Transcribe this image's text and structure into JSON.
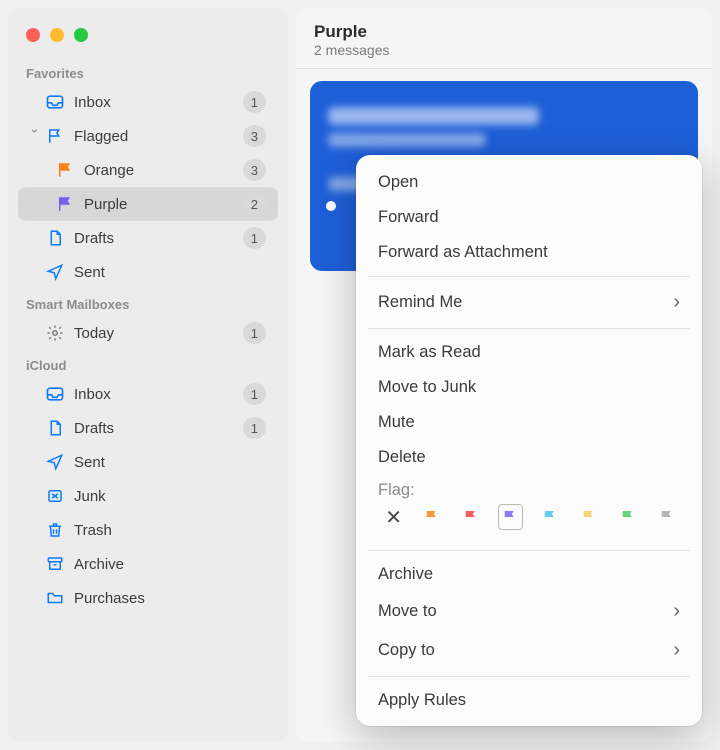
{
  "sidebar": {
    "sections": {
      "favorites": "Favorites",
      "smart": "Smart Mailboxes",
      "icloud": "iCloud"
    },
    "fav": {
      "inbox": {
        "label": "Inbox",
        "count": "1"
      },
      "flagged": {
        "label": "Flagged",
        "count": "3"
      },
      "orange": {
        "label": "Orange",
        "count": "3"
      },
      "purple": {
        "label": "Purple",
        "count": "2"
      },
      "drafts": {
        "label": "Drafts",
        "count": "1"
      },
      "sent": {
        "label": "Sent"
      }
    },
    "smart": {
      "today": {
        "label": "Today",
        "count": "1"
      }
    },
    "icloud": {
      "inbox": {
        "label": "Inbox",
        "count": "1"
      },
      "drafts": {
        "label": "Drafts",
        "count": "1"
      },
      "sent": {
        "label": "Sent"
      },
      "junk": {
        "label": "Junk"
      },
      "trash": {
        "label": "Trash"
      },
      "archive": {
        "label": "Archive"
      },
      "purchases": {
        "label": "Purchases"
      }
    }
  },
  "main": {
    "title": "Purple",
    "messages_count": "2 messages"
  },
  "context_menu": {
    "open": "Open",
    "forward": "Forward",
    "forward_attachment": "Forward as Attachment",
    "remind_me": "Remind Me",
    "mark_as_read": "Mark as Read",
    "move_to_junk": "Move to Junk",
    "mute": "Mute",
    "delete": "Delete",
    "flag_label": "Flag:",
    "archive": "Archive",
    "move_to": "Move to",
    "copy_to": "Copy to",
    "apply_rules": "Apply Rules"
  },
  "flag_colors": {
    "orange": "#f59b3c",
    "red": "#f15e5e",
    "purple": "#8a7af8",
    "blue": "#62cdee",
    "yellow": "#f2d879",
    "green": "#63d37a",
    "grey": "#b7b7b7"
  },
  "brand_colors": {
    "selection_bg": "#d7d7d8",
    "highlight_ring": "#f3a72a",
    "message_card_bg": "#1e5fd8",
    "icon_blue": "#0a7aff"
  }
}
